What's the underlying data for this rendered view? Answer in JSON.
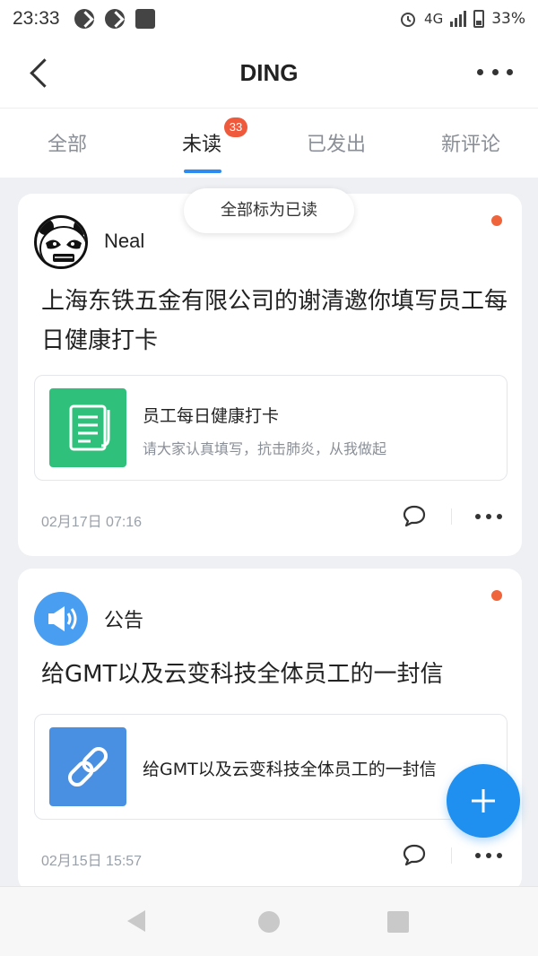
{
  "status_bar": {
    "time": "23:33",
    "network": "4G",
    "battery": "33%"
  },
  "header": {
    "title": "DING"
  },
  "tabs": [
    {
      "label": "全部",
      "active": false
    },
    {
      "label": "未读",
      "active": true,
      "badge": "33"
    },
    {
      "label": "已发出",
      "active": false
    },
    {
      "label": "新评论",
      "active": false
    }
  ],
  "mark_all_read_label": "全部标为已读",
  "messages": [
    {
      "sender": "Neal",
      "title": "上海东铁五金有限公司的谢清邀你填写员工每日健康打卡",
      "attachment": {
        "title": "员工每日健康打卡",
        "subtitle": "请大家认真填写，抗击肺炎，从我做起",
        "icon": "form-icon",
        "color": "#2fc07c"
      },
      "time": "02月17日 07:16",
      "unread": true
    },
    {
      "sender": "公告",
      "title": "给GMT以及云变科技全体员工的一封信",
      "attachment": {
        "title": "给GMT以及云变科技全体员工的一封信",
        "icon": "link-icon",
        "color": "#4a90e2"
      },
      "time": "02月15日 15:57",
      "unread": true
    }
  ],
  "colors": {
    "accent": "#1f8ff0",
    "badge": "#f05a3c",
    "unread_dot": "#f0643c"
  }
}
